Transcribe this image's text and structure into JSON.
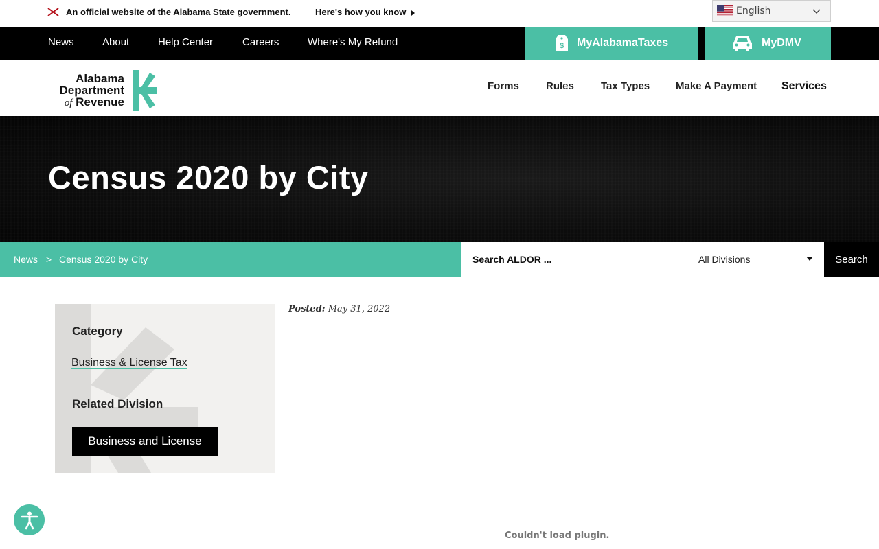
{
  "official_banner": {
    "text": "An official website of the Alabama State government.",
    "how_link": "Here's how you know"
  },
  "language": {
    "selected": "English"
  },
  "utility_nav": {
    "links": [
      "News",
      "About",
      "Help Center",
      "Careers",
      "Where's My Refund"
    ],
    "my_taxes": "MyAlabamaTaxes",
    "my_dmv": "MyDMV"
  },
  "logo": {
    "line1": "Alabama",
    "line2": "Department",
    "line3_of": "of",
    "line3": "Revenue"
  },
  "main_nav": [
    "Forms",
    "Rules",
    "Tax Types",
    "Make A Payment",
    "Services"
  ],
  "hero": {
    "title": "Census 2020 by City"
  },
  "breadcrumb": {
    "items": [
      "News",
      "Census 2020 by City"
    ],
    "separator": ">"
  },
  "search": {
    "placeholder": "Search ALDOR ...",
    "division": "All Divisions",
    "button": "Search"
  },
  "sidebar": {
    "category_heading": "Category",
    "category_link": "Business & License Tax",
    "division_heading": "Related Division",
    "division_button": "Business and License"
  },
  "post": {
    "posted_label": "Posted:",
    "date": "May 31, 2022"
  },
  "plugin_message": "Couldn't load plugin.",
  "colors": {
    "accent": "#4bbfa5",
    "dark": "#000000"
  }
}
